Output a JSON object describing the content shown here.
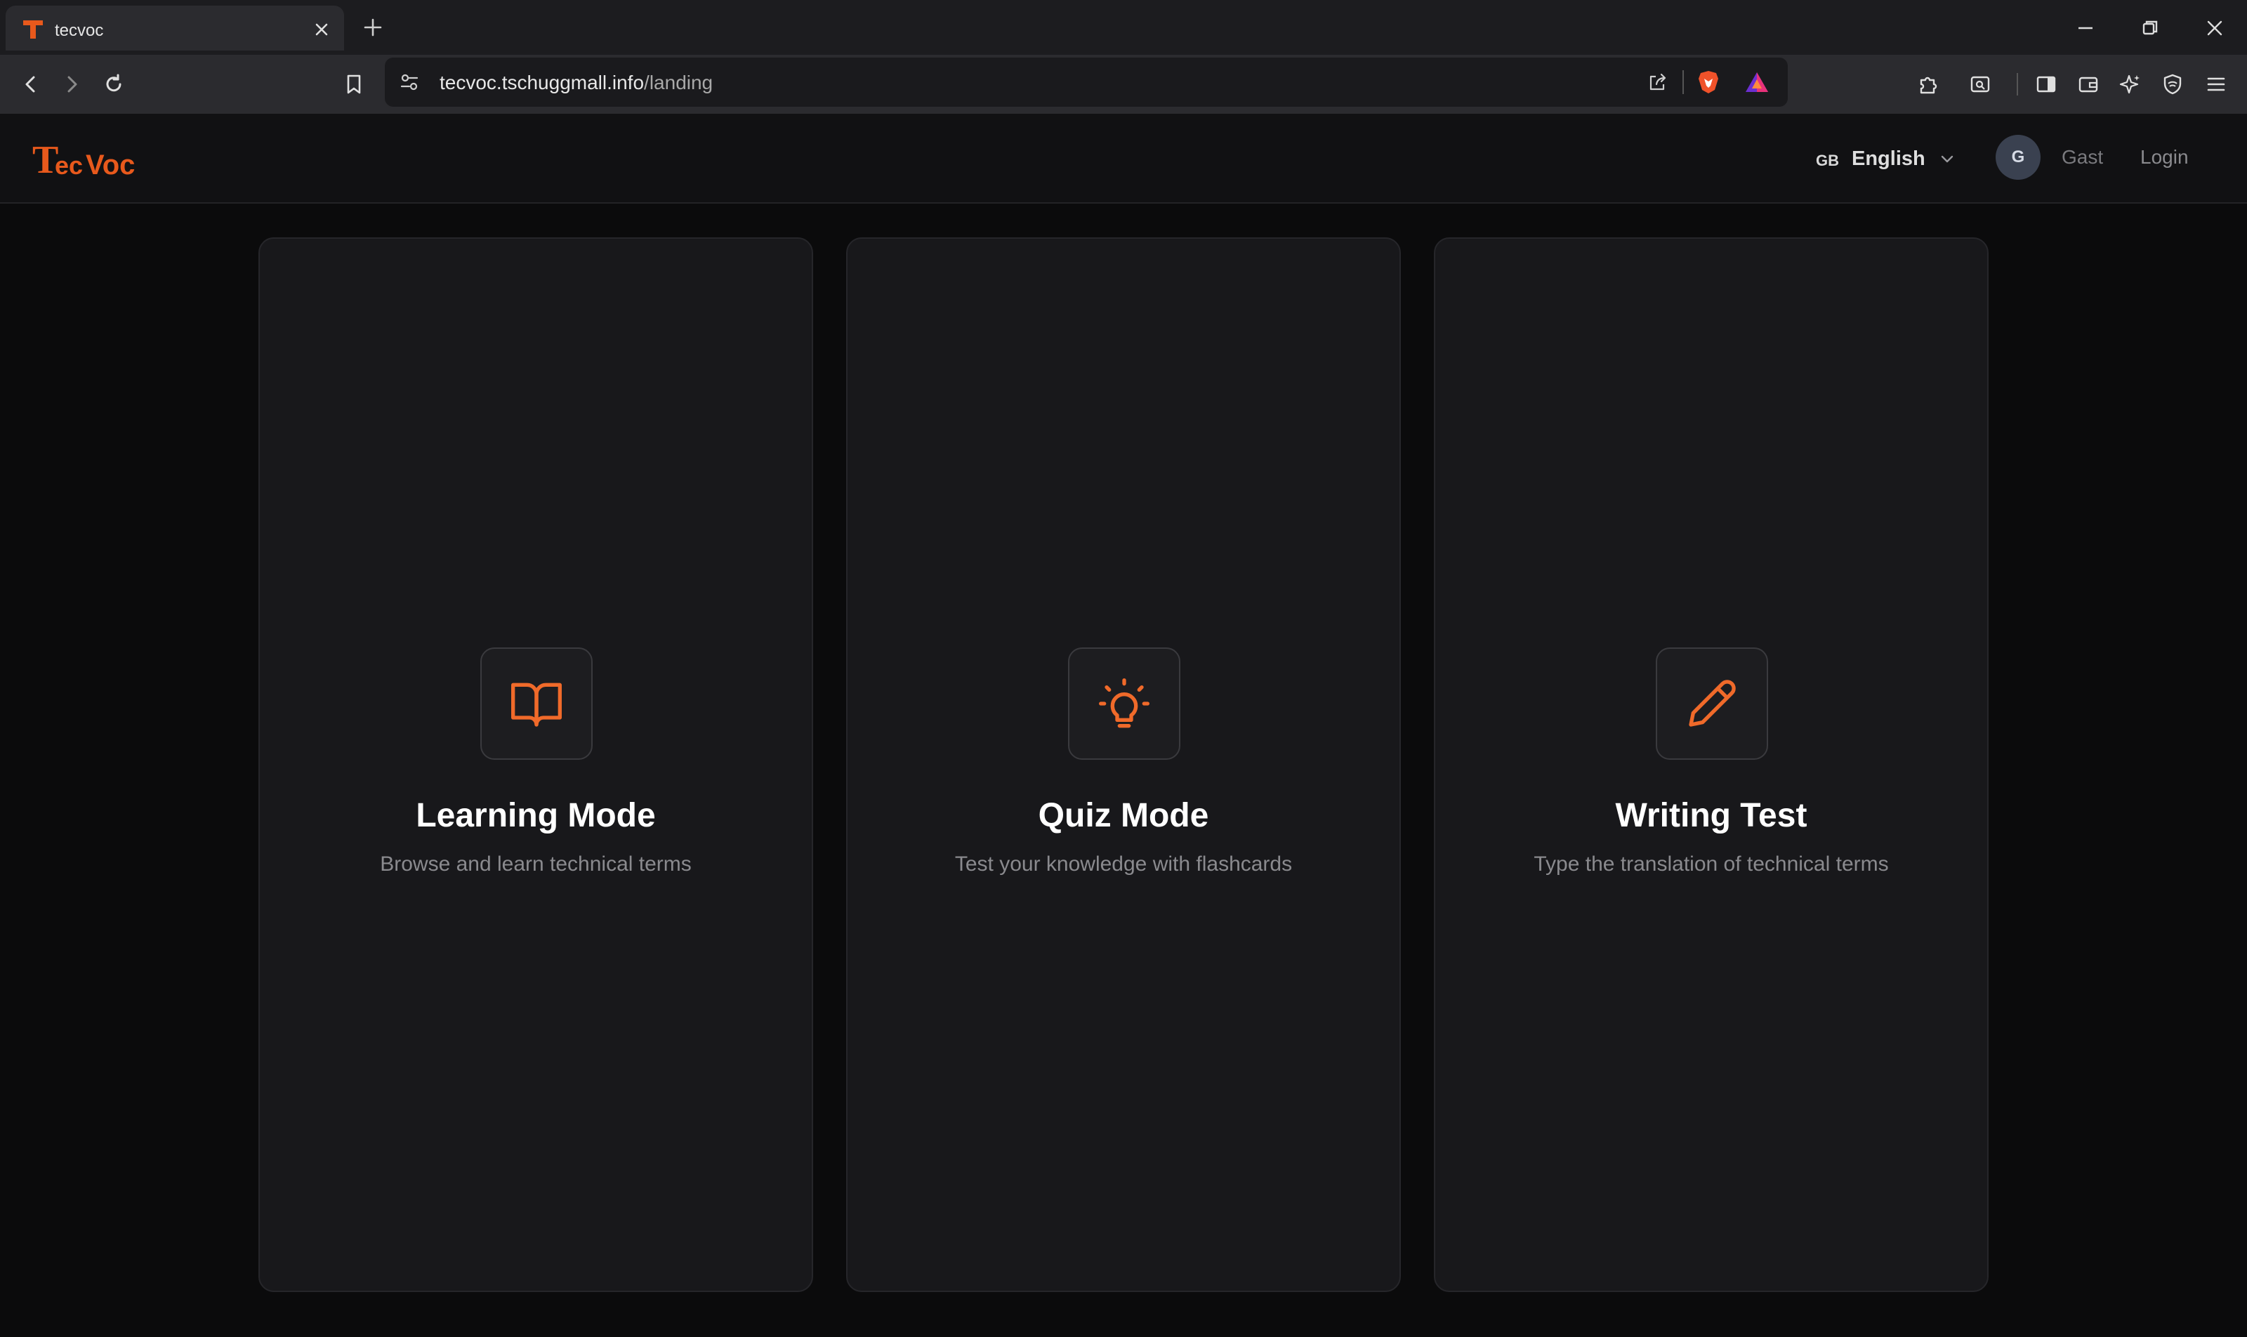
{
  "browser": {
    "tab_title": "tecvoc",
    "url_domain": "tecvoc.tschuggmall.info",
    "url_path": "/landing"
  },
  "header": {
    "logo_text": "TecVoc",
    "language": {
      "flag": "GB",
      "label": "English"
    },
    "user": {
      "initial": "G",
      "name": "Gast"
    },
    "login_label": "Login"
  },
  "modes": [
    {
      "icon": "book-open-icon",
      "title": "Learning Mode",
      "description": "Browse and learn technical terms"
    },
    {
      "icon": "lightbulb-icon",
      "title": "Quiz Mode",
      "description": "Test your knowledge with flashcards"
    },
    {
      "icon": "pencil-icon",
      "title": "Writing Test",
      "description": "Type the translation of technical terms"
    }
  ],
  "colors": {
    "accent": "#f06a2a",
    "card_bg": "#18181b",
    "page_bg": "#0b0b0c"
  }
}
